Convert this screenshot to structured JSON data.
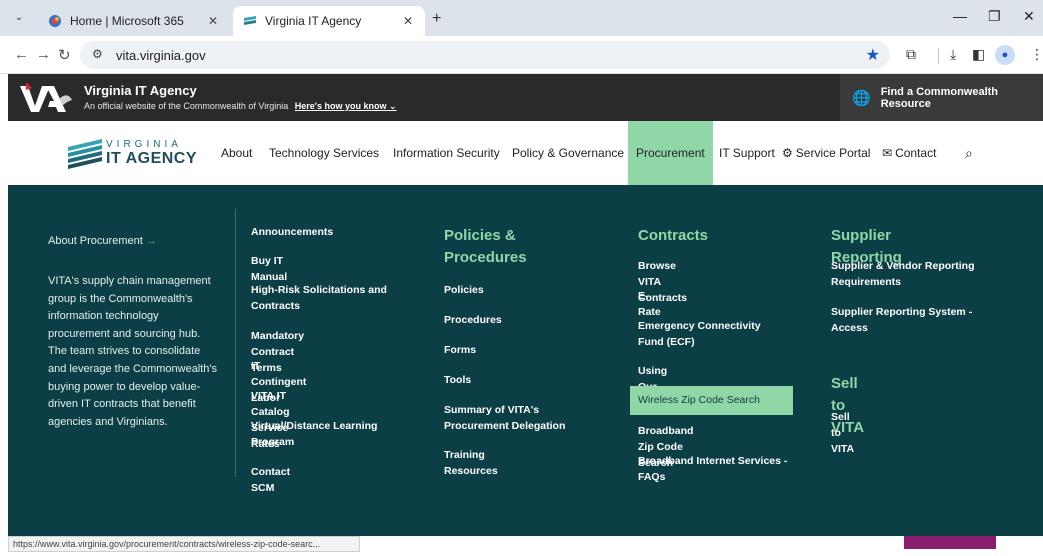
{
  "browser": {
    "tabs": [
      {
        "title": "Home | Microsoft 365",
        "active": false
      },
      {
        "title": "Virginia IT Agency",
        "active": true
      }
    ],
    "url": "vita.virginia.gov",
    "status_url": "https://www.vita.virginia.gov/procurement/contracts/wireless-zip-code-searc..."
  },
  "gov_banner": {
    "title": "Virginia IT Agency",
    "subtitle": "An official website of the Commonwealth of Virginia",
    "how_link": "Here's how you know",
    "resource_button": "Find a Commonwealth Resource"
  },
  "logo": {
    "line1": "VIRGINIA",
    "line2": "IT AGENCY"
  },
  "nav": {
    "items": [
      "About",
      "Technology Services",
      "Information Security",
      "Policy & Governance",
      "Procurement",
      "IT Support",
      "Service Portal",
      "Contact"
    ],
    "active": "Procurement"
  },
  "mega": {
    "about_title": "About Procurement",
    "about_text": "VITA's supply chain management group is the Commonwealth's information technology procurement and sourcing hub. The team strives to consolidate and leverage the Commonwealth's buying power to develop value-driven IT contracts that benefit agencies and Virginians.",
    "col1": [
      "Announcements",
      "Buy IT Manual",
      "High-Risk Solicitations and Contracts",
      "Mandatory Contract Terms",
      "IT Contingent Labor",
      "VITA IT Catalog Service Rates",
      "Virtual/Distance Learning Program",
      "Contact SCM"
    ],
    "policies": {
      "heading": "Policies & Procedures",
      "links": [
        "Policies",
        "Procedures",
        "Forms",
        "Tools",
        "Summary of VITA's Procurement Delegation",
        "Training Resources"
      ]
    },
    "contracts": {
      "heading": "Contracts",
      "links": [
        "Browse VITA Contracts",
        "E-Rate",
        "Emergency Connectivity Fund (ECF)",
        "Using Our Services",
        "Wireless Zip Code Search",
        "Broadband Zip Code Search",
        "Broadband Internet Services - FAQs"
      ],
      "highlighted": "Wireless Zip Code Search"
    },
    "supplier": {
      "heading": "Supplier Reporting",
      "links": [
        "Supplier & Vendor Reporting Requirements",
        "Supplier Reporting System - Access"
      ]
    },
    "sell": {
      "heading": "Sell to VITA",
      "links": [
        "Sell to VITA"
      ]
    }
  },
  "colors": {
    "menu_bg": "#0c3f45",
    "accent_green": "#8fd7a7",
    "gov_bar": "#2a2a2a"
  }
}
